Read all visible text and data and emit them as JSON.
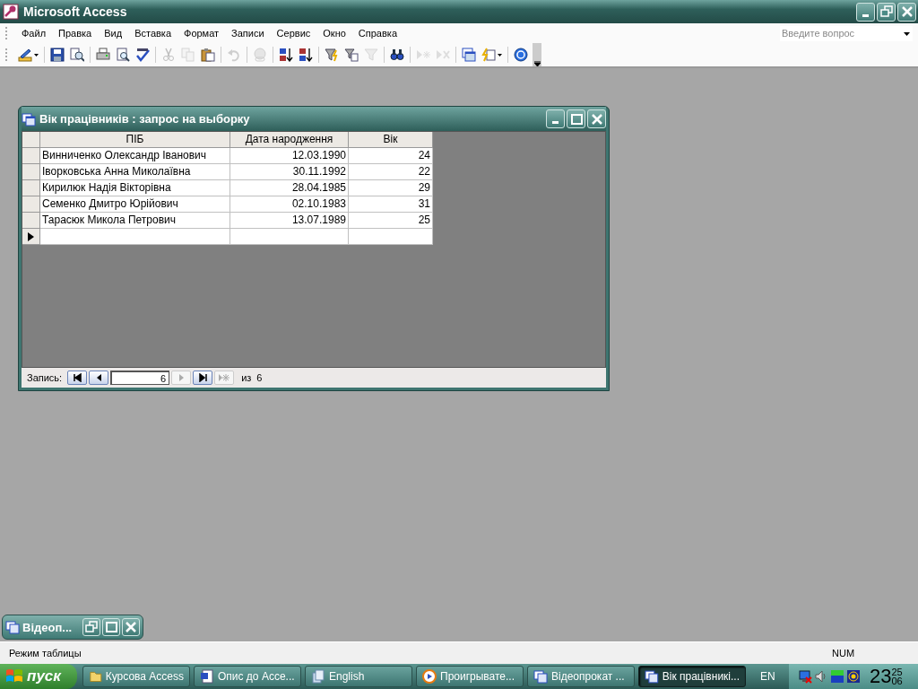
{
  "window": {
    "title": "Microsoft Access"
  },
  "menu": [
    "Файл",
    "Правка",
    "Вид",
    "Вставка",
    "Формат",
    "Записи",
    "Сервис",
    "Окно",
    "Справка"
  ],
  "question_box": {
    "placeholder": "Введите вопрос"
  },
  "toolbar": {
    "groups": [
      {
        "buttons": [
          {
            "kind": "design",
            "disabled": false
          }
        ]
      },
      {
        "buttons": [
          {
            "kind": "save",
            "disabled": false
          },
          {
            "kind": "research",
            "disabled": false
          }
        ]
      },
      {
        "buttons": [
          {
            "kind": "print",
            "disabled": false
          },
          {
            "kind": "preview",
            "disabled": false
          },
          {
            "kind": "spelling",
            "disabled": false
          }
        ]
      },
      {
        "buttons": [
          {
            "kind": "cut",
            "disabled": true
          },
          {
            "kind": "copy",
            "disabled": true
          },
          {
            "kind": "paste",
            "disabled": false
          }
        ]
      },
      {
        "buttons": [
          {
            "kind": "undo",
            "disabled": true
          }
        ]
      },
      {
        "buttons": [
          {
            "kind": "hyperlink",
            "disabled": true
          }
        ]
      },
      {
        "buttons": [
          {
            "kind": "sortup",
            "disabled": false
          },
          {
            "kind": "sortdown",
            "disabled": false
          }
        ]
      },
      {
        "buttons": [
          {
            "kind": "filtersel",
            "disabled": false
          },
          {
            "kind": "filterform",
            "disabled": false
          },
          {
            "kind": "filter",
            "disabled": true
          }
        ]
      },
      {
        "buttons": [
          {
            "kind": "find",
            "disabled": false
          }
        ]
      },
      {
        "buttons": [
          {
            "kind": "newrec",
            "disabled": true
          },
          {
            "kind": "delrec",
            "disabled": true
          }
        ]
      },
      {
        "buttons": [
          {
            "kind": "dbwindow",
            "disabled": false
          },
          {
            "kind": "newobject",
            "disabled": false
          }
        ]
      },
      {
        "buttons": [
          {
            "kind": "help",
            "disabled": false
          }
        ]
      }
    ]
  },
  "query_window": {
    "title": "Вік працівників : запрос на выборку",
    "table": {
      "columns": [
        {
          "label": "ПІБ"
        },
        {
          "label": "Дата народження"
        },
        {
          "label": "Вік"
        }
      ],
      "rows": [
        {
          "cells": [
            "Винниченко Олександр Іванович",
            "12.03.1990",
            "24"
          ],
          "current": false
        },
        {
          "cells": [
            "Іворковська Анна Миколаївна",
            "30.11.1992",
            "22"
          ],
          "current": false
        },
        {
          "cells": [
            "Кирилюк Надія Вікторівна",
            "28.04.1985",
            "29"
          ],
          "current": false
        },
        {
          "cells": [
            "Семенко Дмитро Юрійович",
            "02.10.1983",
            "31"
          ],
          "current": false
        },
        {
          "cells": [
            "Тарасюк Микола Петрович",
            "13.07.1989",
            "25"
          ],
          "current": false
        },
        {
          "cells": [
            "",
            "",
            ""
          ],
          "current": true
        }
      ]
    },
    "navigator": {
      "label": "Запись:",
      "record": "6",
      "of_label": "из",
      "total": "6",
      "buttons_before": [
        {
          "kind": "first",
          "disabled": false
        },
        {
          "kind": "prev",
          "disabled": false
        }
      ],
      "buttons_after": [
        {
          "kind": "next",
          "disabled": true
        },
        {
          "kind": "last",
          "disabled": false
        },
        {
          "kind": "new",
          "disabled": true
        }
      ]
    }
  },
  "minimized_window": {
    "title": "Відеоп..."
  },
  "status_bar": {
    "mode": "Режим таблицы",
    "indicator": "NUM"
  },
  "taskbar": {
    "start": "пуск",
    "buttons": [
      {
        "label": "Курсова Access",
        "kind": "folder",
        "selected": false
      },
      {
        "label": "Опис до Acce...",
        "kind": "word",
        "selected": false
      },
      {
        "label": "English",
        "kind": "stack",
        "selected": false
      },
      {
        "label": "Проигрывате...",
        "kind": "player",
        "selected": false
      },
      {
        "label": "Відеопрокат ...",
        "kind": "form",
        "selected": false
      },
      {
        "label": "Вік працівникі...",
        "kind": "form",
        "selected": true
      }
    ],
    "language": "EN",
    "clock": {
      "hours": "23",
      "minutes": "25",
      "seconds": "06"
    }
  }
}
